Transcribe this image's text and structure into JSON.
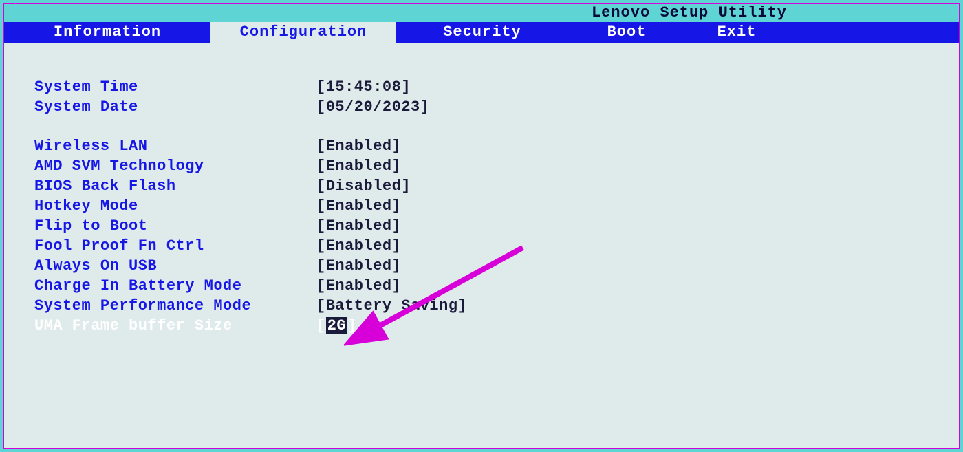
{
  "title": "Lenovo Setup Utility",
  "tabs": {
    "t0": "Information",
    "t1": "Configuration",
    "t2": "Security",
    "t3": "Boot",
    "t4": "Exit"
  },
  "rows": {
    "system_time": {
      "label": "System Time",
      "value": "[15:45:08]"
    },
    "system_date": {
      "label": "System Date",
      "value": "[05/20/2023]"
    },
    "wireless_lan": {
      "label": "Wireless LAN",
      "value": "[Enabled]"
    },
    "amd_svm": {
      "label": "AMD SVM Technology",
      "value": "[Enabled]"
    },
    "bios_back_flash": {
      "label": "BIOS Back Flash",
      "value": "[Disabled]"
    },
    "hotkey_mode": {
      "label": "Hotkey Mode",
      "value": "[Enabled]"
    },
    "flip_to_boot": {
      "label": "Flip to Boot",
      "value": "[Enabled]"
    },
    "fool_proof": {
      "label": "Fool Proof Fn Ctrl",
      "value": "[Enabled]"
    },
    "always_on_usb": {
      "label": "Always On USB",
      "value": "[Enabled]"
    },
    "charge_battery": {
      "label": "Charge In Battery Mode",
      "value": "[Enabled]"
    },
    "perf_mode": {
      "label": "System Performance Mode",
      "value": "[Battery Saving]"
    },
    "uma": {
      "label": "UMA Frame buffer Size",
      "lbr": "[",
      "inner": "2G",
      "rbr": "]"
    }
  }
}
